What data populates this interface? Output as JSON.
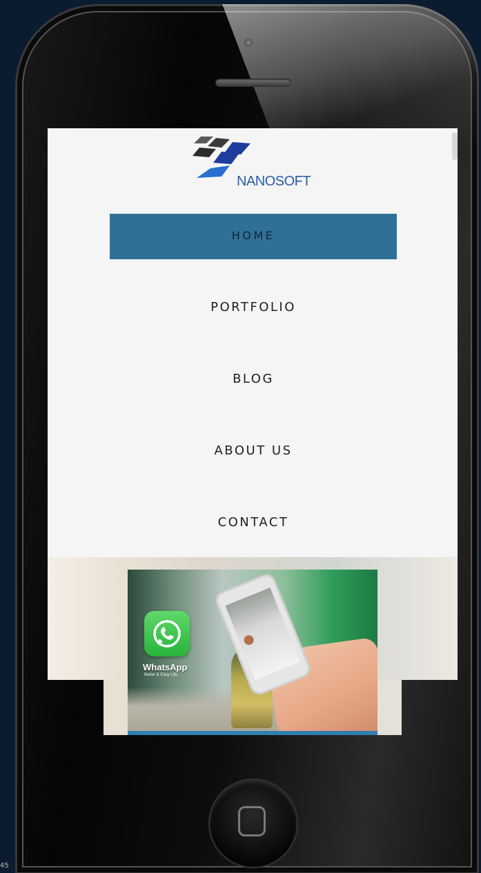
{
  "brand": {
    "name": "NANOSOFT",
    "colors": {
      "logo_dark": "#3a3a3a",
      "logo_blue": "#1f3d9c",
      "logo_text": "#2a5ba8"
    }
  },
  "nav": {
    "items": [
      {
        "label": "HOME",
        "active": true
      },
      {
        "label": "PORTFOLIO",
        "active": false
      },
      {
        "label": "BLOG",
        "active": false
      },
      {
        "label": "ABOUT US",
        "active": false
      },
      {
        "label": "CONTACT",
        "active": false
      }
    ],
    "active_color": "#2f7196"
  },
  "hero": {
    "app_title": "WhatsApp",
    "app_tagline": "Better & Easy Life",
    "app_icon": "whatsapp-icon",
    "accent_color": "#2f7fb0"
  },
  "device": {
    "icons": [
      "camera-icon",
      "speaker-icon",
      "home-button-icon"
    ]
  },
  "corner_mark": "45"
}
